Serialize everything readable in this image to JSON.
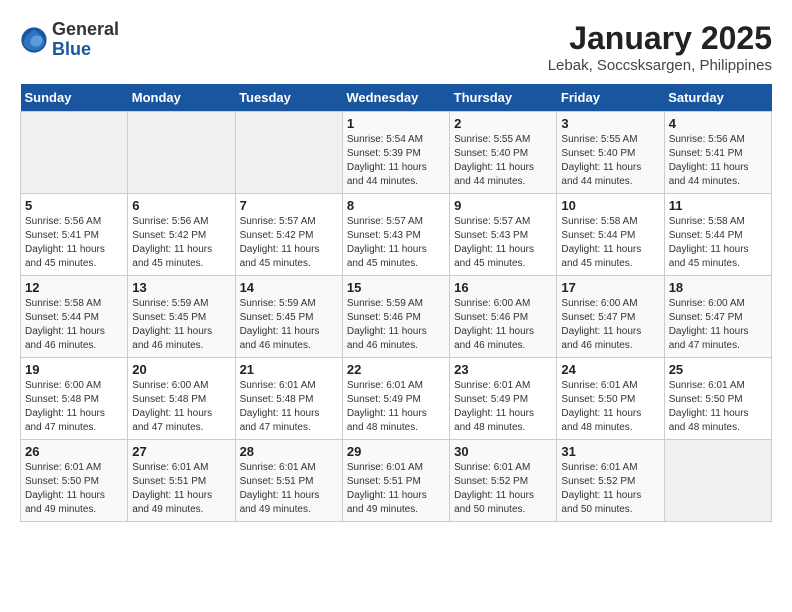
{
  "header": {
    "logo_general": "General",
    "logo_blue": "Blue",
    "title": "January 2025",
    "subtitle": "Lebak, Soccsksargen, Philippines"
  },
  "weekdays": [
    "Sunday",
    "Monday",
    "Tuesday",
    "Wednesday",
    "Thursday",
    "Friday",
    "Saturday"
  ],
  "weeks": [
    [
      {
        "day": "",
        "sunrise": "",
        "sunset": "",
        "daylight": "",
        "empty": true
      },
      {
        "day": "",
        "sunrise": "",
        "sunset": "",
        "daylight": "",
        "empty": true
      },
      {
        "day": "",
        "sunrise": "",
        "sunset": "",
        "daylight": "",
        "empty": true
      },
      {
        "day": "1",
        "sunrise": "Sunrise: 5:54 AM",
        "sunset": "Sunset: 5:39 PM",
        "daylight": "Daylight: 11 hours and 44 minutes.",
        "empty": false
      },
      {
        "day": "2",
        "sunrise": "Sunrise: 5:55 AM",
        "sunset": "Sunset: 5:40 PM",
        "daylight": "Daylight: 11 hours and 44 minutes.",
        "empty": false
      },
      {
        "day": "3",
        "sunrise": "Sunrise: 5:55 AM",
        "sunset": "Sunset: 5:40 PM",
        "daylight": "Daylight: 11 hours and 44 minutes.",
        "empty": false
      },
      {
        "day": "4",
        "sunrise": "Sunrise: 5:56 AM",
        "sunset": "Sunset: 5:41 PM",
        "daylight": "Daylight: 11 hours and 44 minutes.",
        "empty": false
      }
    ],
    [
      {
        "day": "5",
        "sunrise": "Sunrise: 5:56 AM",
        "sunset": "Sunset: 5:41 PM",
        "daylight": "Daylight: 11 hours and 45 minutes.",
        "empty": false
      },
      {
        "day": "6",
        "sunrise": "Sunrise: 5:56 AM",
        "sunset": "Sunset: 5:42 PM",
        "daylight": "Daylight: 11 hours and 45 minutes.",
        "empty": false
      },
      {
        "day": "7",
        "sunrise": "Sunrise: 5:57 AM",
        "sunset": "Sunset: 5:42 PM",
        "daylight": "Daylight: 11 hours and 45 minutes.",
        "empty": false
      },
      {
        "day": "8",
        "sunrise": "Sunrise: 5:57 AM",
        "sunset": "Sunset: 5:43 PM",
        "daylight": "Daylight: 11 hours and 45 minutes.",
        "empty": false
      },
      {
        "day": "9",
        "sunrise": "Sunrise: 5:57 AM",
        "sunset": "Sunset: 5:43 PM",
        "daylight": "Daylight: 11 hours and 45 minutes.",
        "empty": false
      },
      {
        "day": "10",
        "sunrise": "Sunrise: 5:58 AM",
        "sunset": "Sunset: 5:44 PM",
        "daylight": "Daylight: 11 hours and 45 minutes.",
        "empty": false
      },
      {
        "day": "11",
        "sunrise": "Sunrise: 5:58 AM",
        "sunset": "Sunset: 5:44 PM",
        "daylight": "Daylight: 11 hours and 45 minutes.",
        "empty": false
      }
    ],
    [
      {
        "day": "12",
        "sunrise": "Sunrise: 5:58 AM",
        "sunset": "Sunset: 5:44 PM",
        "daylight": "Daylight: 11 hours and 46 minutes.",
        "empty": false
      },
      {
        "day": "13",
        "sunrise": "Sunrise: 5:59 AM",
        "sunset": "Sunset: 5:45 PM",
        "daylight": "Daylight: 11 hours and 46 minutes.",
        "empty": false
      },
      {
        "day": "14",
        "sunrise": "Sunrise: 5:59 AM",
        "sunset": "Sunset: 5:45 PM",
        "daylight": "Daylight: 11 hours and 46 minutes.",
        "empty": false
      },
      {
        "day": "15",
        "sunrise": "Sunrise: 5:59 AM",
        "sunset": "Sunset: 5:46 PM",
        "daylight": "Daylight: 11 hours and 46 minutes.",
        "empty": false
      },
      {
        "day": "16",
        "sunrise": "Sunrise: 6:00 AM",
        "sunset": "Sunset: 5:46 PM",
        "daylight": "Daylight: 11 hours and 46 minutes.",
        "empty": false
      },
      {
        "day": "17",
        "sunrise": "Sunrise: 6:00 AM",
        "sunset": "Sunset: 5:47 PM",
        "daylight": "Daylight: 11 hours and 46 minutes.",
        "empty": false
      },
      {
        "day": "18",
        "sunrise": "Sunrise: 6:00 AM",
        "sunset": "Sunset: 5:47 PM",
        "daylight": "Daylight: 11 hours and 47 minutes.",
        "empty": false
      }
    ],
    [
      {
        "day": "19",
        "sunrise": "Sunrise: 6:00 AM",
        "sunset": "Sunset: 5:48 PM",
        "daylight": "Daylight: 11 hours and 47 minutes.",
        "empty": false
      },
      {
        "day": "20",
        "sunrise": "Sunrise: 6:00 AM",
        "sunset": "Sunset: 5:48 PM",
        "daylight": "Daylight: 11 hours and 47 minutes.",
        "empty": false
      },
      {
        "day": "21",
        "sunrise": "Sunrise: 6:01 AM",
        "sunset": "Sunset: 5:48 PM",
        "daylight": "Daylight: 11 hours and 47 minutes.",
        "empty": false
      },
      {
        "day": "22",
        "sunrise": "Sunrise: 6:01 AM",
        "sunset": "Sunset: 5:49 PM",
        "daylight": "Daylight: 11 hours and 48 minutes.",
        "empty": false
      },
      {
        "day": "23",
        "sunrise": "Sunrise: 6:01 AM",
        "sunset": "Sunset: 5:49 PM",
        "daylight": "Daylight: 11 hours and 48 minutes.",
        "empty": false
      },
      {
        "day": "24",
        "sunrise": "Sunrise: 6:01 AM",
        "sunset": "Sunset: 5:50 PM",
        "daylight": "Daylight: 11 hours and 48 minutes.",
        "empty": false
      },
      {
        "day": "25",
        "sunrise": "Sunrise: 6:01 AM",
        "sunset": "Sunset: 5:50 PM",
        "daylight": "Daylight: 11 hours and 48 minutes.",
        "empty": false
      }
    ],
    [
      {
        "day": "26",
        "sunrise": "Sunrise: 6:01 AM",
        "sunset": "Sunset: 5:50 PM",
        "daylight": "Daylight: 11 hours and 49 minutes.",
        "empty": false
      },
      {
        "day": "27",
        "sunrise": "Sunrise: 6:01 AM",
        "sunset": "Sunset: 5:51 PM",
        "daylight": "Daylight: 11 hours and 49 minutes.",
        "empty": false
      },
      {
        "day": "28",
        "sunrise": "Sunrise: 6:01 AM",
        "sunset": "Sunset: 5:51 PM",
        "daylight": "Daylight: 11 hours and 49 minutes.",
        "empty": false
      },
      {
        "day": "29",
        "sunrise": "Sunrise: 6:01 AM",
        "sunset": "Sunset: 5:51 PM",
        "daylight": "Daylight: 11 hours and 49 minutes.",
        "empty": false
      },
      {
        "day": "30",
        "sunrise": "Sunrise: 6:01 AM",
        "sunset": "Sunset: 5:52 PM",
        "daylight": "Daylight: 11 hours and 50 minutes.",
        "empty": false
      },
      {
        "day": "31",
        "sunrise": "Sunrise: 6:01 AM",
        "sunset": "Sunset: 5:52 PM",
        "daylight": "Daylight: 11 hours and 50 minutes.",
        "empty": false
      },
      {
        "day": "",
        "sunrise": "",
        "sunset": "",
        "daylight": "",
        "empty": true
      }
    ]
  ]
}
